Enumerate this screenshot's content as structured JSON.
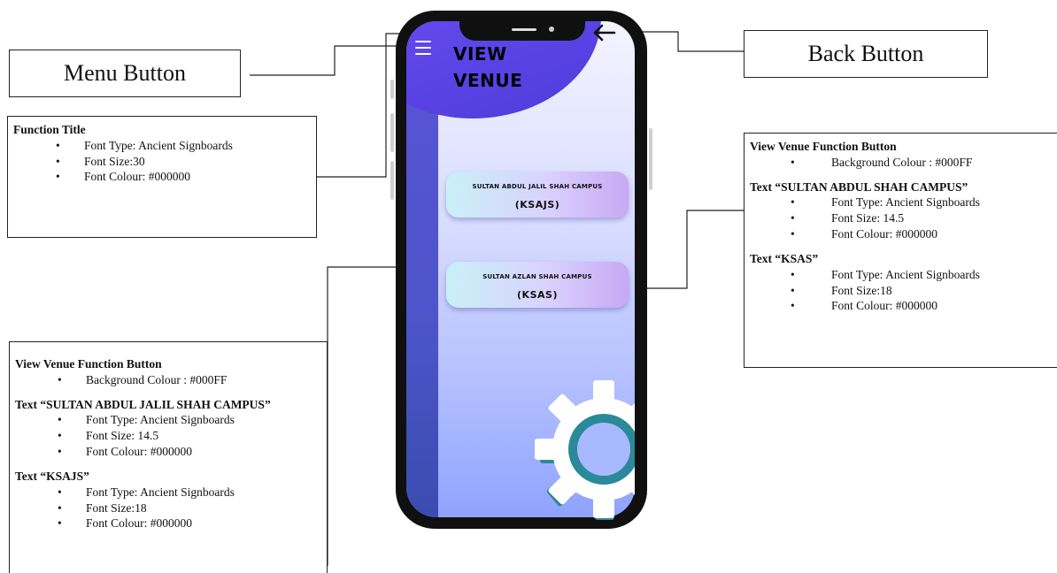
{
  "phone": {
    "title_lines": [
      "VIEW",
      "VENUE"
    ],
    "buttons": [
      {
        "line1": "SULTAN ABDUL JALIL SHAH CAMPUS",
        "line2": "(KSAJS)"
      },
      {
        "line1": "SULTAN AZLAN SHAH CAMPUS",
        "line2": "(KSAS)"
      }
    ],
    "icons": {
      "menu": "hamburger-menu-icon",
      "back": "back-arrow-icon",
      "decor": "gear-icon"
    }
  },
  "callouts": {
    "menu_button": "Menu Button",
    "back_button": "Back Button",
    "function_title": {
      "heading": "Function Title",
      "items": [
        "Font Type: Ancient Signboards",
        "Font Size:30",
        "Font Colour: #000000"
      ]
    },
    "right_spec": {
      "heading1": "View Venue Function Button",
      "items1": [
        "Background Colour : #000FF"
      ],
      "heading2": "Text “SULTAN ABDUL SHAH CAMPUS”",
      "items2": [
        "Font Type: Ancient Signboards",
        "Font Size: 14.5",
        "Font Colour: #000000"
      ],
      "heading3": "Text “KSAS”",
      "items3": [
        "Font Type: Ancient Signboards",
        "Font Size:18",
        "Font Colour: #000000"
      ]
    },
    "left_spec": {
      "heading1": "View Venue Function Button",
      "items1": [
        "Background Colour : #000FF"
      ],
      "heading2": "Text “SULTAN ABDUL JALIL SHAH CAMPUS”",
      "items2": [
        "Font Type: Ancient Signboards",
        "Font Size: 14.5",
        "Font Colour: #000000"
      ],
      "heading3": "Text “KSAJS”",
      "items3": [
        "Font Type: Ancient Signboards",
        "Font Size:18",
        "Font Colour: #000000"
      ]
    }
  },
  "colors": {
    "accent_purple": "#5d45e8",
    "rail_blue": "#4d55c9",
    "gear_teal": "#2a8a99",
    "frame": "#101010"
  }
}
